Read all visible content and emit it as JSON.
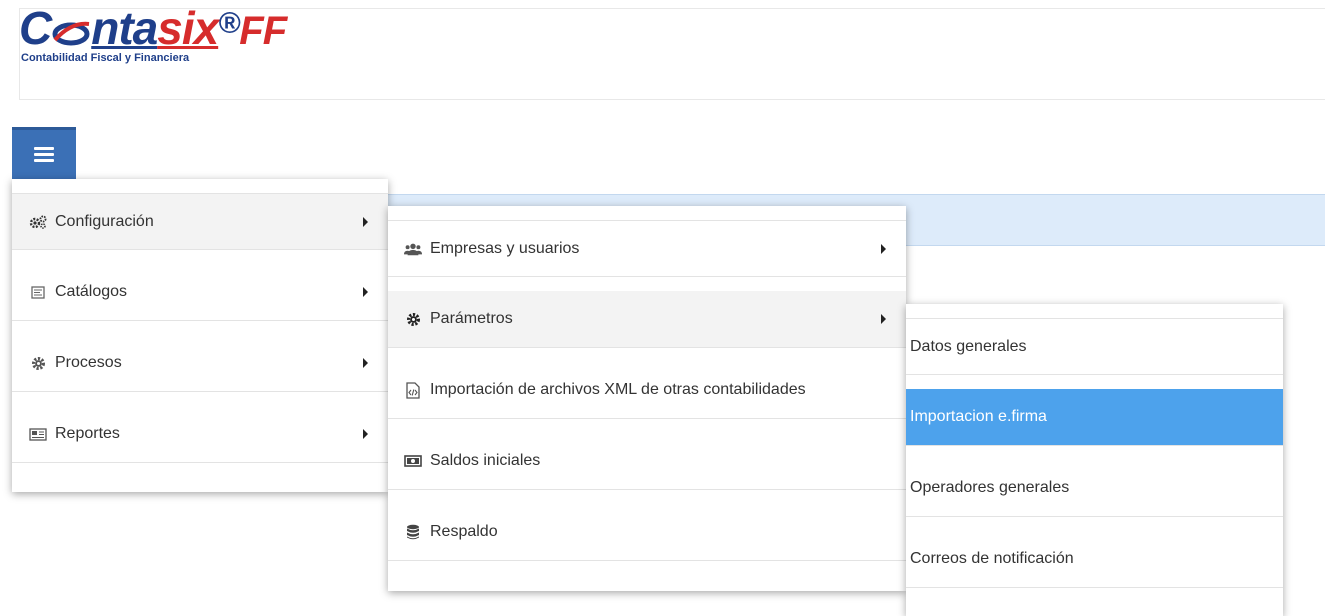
{
  "logo": {
    "brand_part1": "C",
    "brand_part2": "nta",
    "brand_part3": "six",
    "brand_registered": "®",
    "brand_part4": "FF",
    "tagline": "Contabilidad Fiscal y Financiera"
  },
  "menu_level1": {
    "items": [
      {
        "label": "Configuración",
        "icon": "gears-icon"
      },
      {
        "label": "Catálogos",
        "icon": "catalog-icon"
      },
      {
        "label": "Procesos",
        "icon": "gear-icon"
      },
      {
        "label": "Reportes",
        "icon": "report-icon"
      }
    ]
  },
  "menu_level2": {
    "items": [
      {
        "label": "Empresas y usuarios",
        "icon": "users-icon"
      },
      {
        "label": "Parámetros",
        "icon": "gear-icon"
      },
      {
        "label": "Importación de archivos XML de otras contabilidades",
        "icon": "xml-file-icon"
      },
      {
        "label": "Saldos iniciales",
        "icon": "money-icon"
      },
      {
        "label": "Respaldo",
        "icon": "database-icon"
      }
    ]
  },
  "menu_level3": {
    "items": [
      {
        "label": "Datos generales"
      },
      {
        "label": "Importacion e.firma"
      },
      {
        "label": "Operadores generales"
      },
      {
        "label": "Correos de notificación"
      }
    ]
  },
  "colors": {
    "hamburger": "#3b70b6",
    "selected_item": "#4da2ec",
    "strip": "#ddebfa"
  }
}
